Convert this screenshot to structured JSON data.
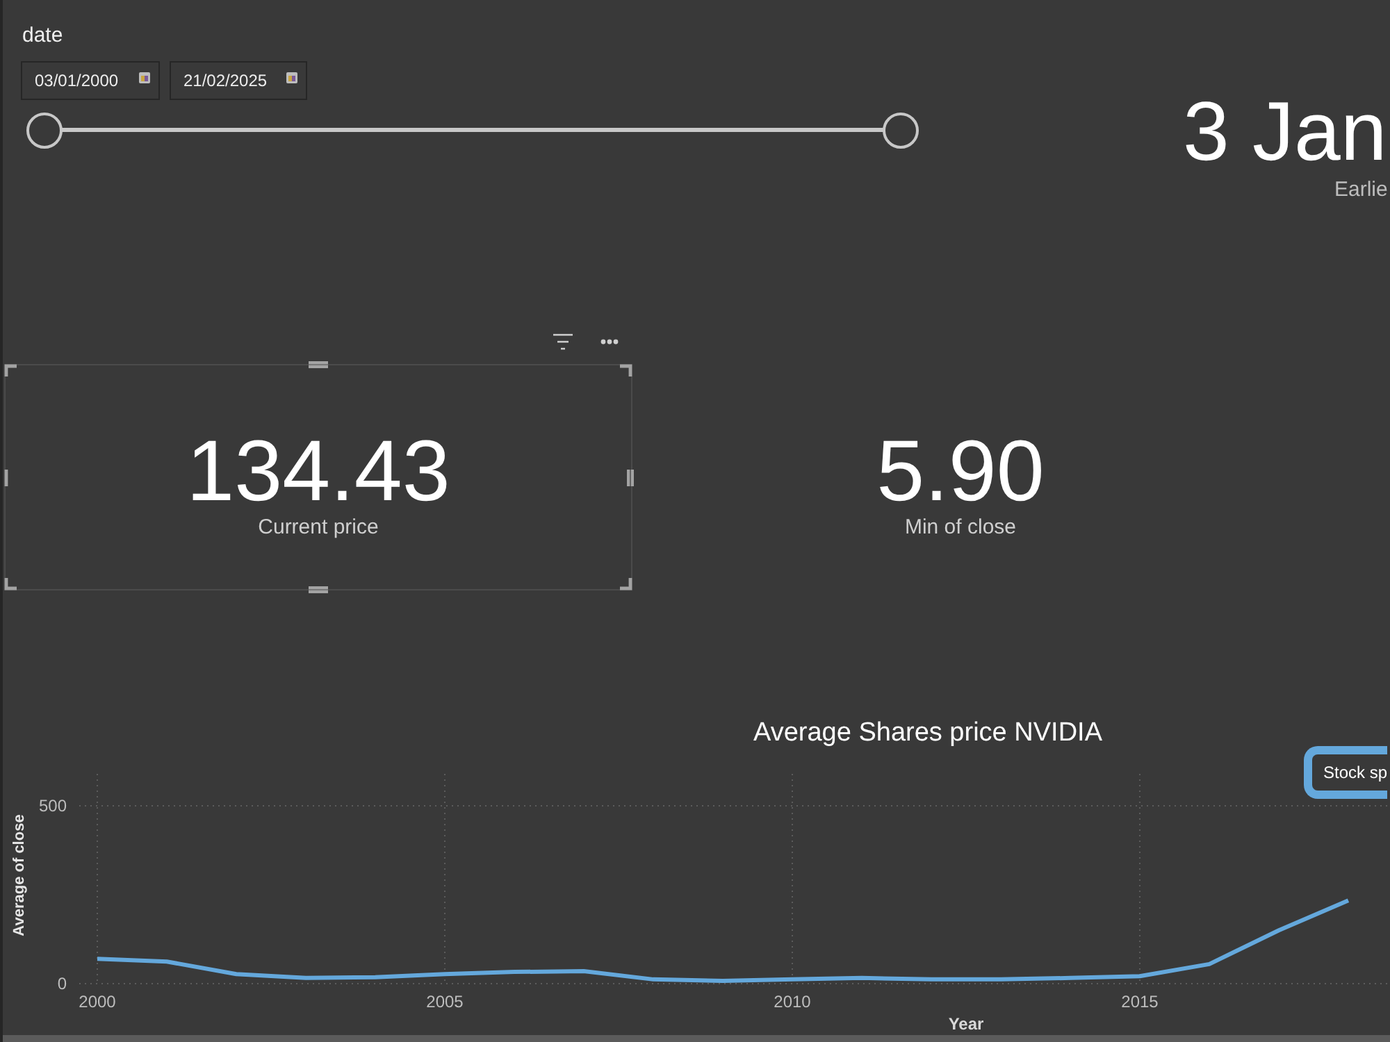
{
  "slicer": {
    "label": "date",
    "start_date": "03/01/2000",
    "end_date": "21/02/2025",
    "thumbs": [
      {
        "level": 0
      },
      {
        "level": 1
      }
    ]
  },
  "date_card": {
    "value": "3 Jan",
    "label": "Earlie"
  },
  "kpi_cards": [
    {
      "value": "134.43",
      "label": "Current price",
      "selected": true
    },
    {
      "value": "5.90",
      "label": "Min of close",
      "selected": false
    }
  ],
  "chart": {
    "chart_data": {
      "type": "line",
      "title": "Average Shares price NVIDIA",
      "xlabel": "Year",
      "ylabel": "Average of close",
      "x": [
        2000,
        2001,
        2002,
        2003,
        2004,
        2005,
        2006,
        2007,
        2008,
        2009,
        2010,
        2011,
        2012,
        2013,
        2014,
        2015,
        2016,
        2017,
        2018
      ],
      "values": [
        70,
        62,
        27,
        16,
        18,
        27,
        33,
        35,
        12,
        8,
        12,
        16,
        12,
        12,
        16,
        21,
        55,
        150,
        234
      ],
      "xlim": [
        2000,
        2018.6
      ],
      "ylim": [
        0,
        590
      ],
      "xticks": [
        2000,
        2005,
        2010,
        2015
      ],
      "yticks": [
        0,
        500
      ],
      "grid": true
    }
  },
  "button": {
    "label": "Stock sp"
  }
}
